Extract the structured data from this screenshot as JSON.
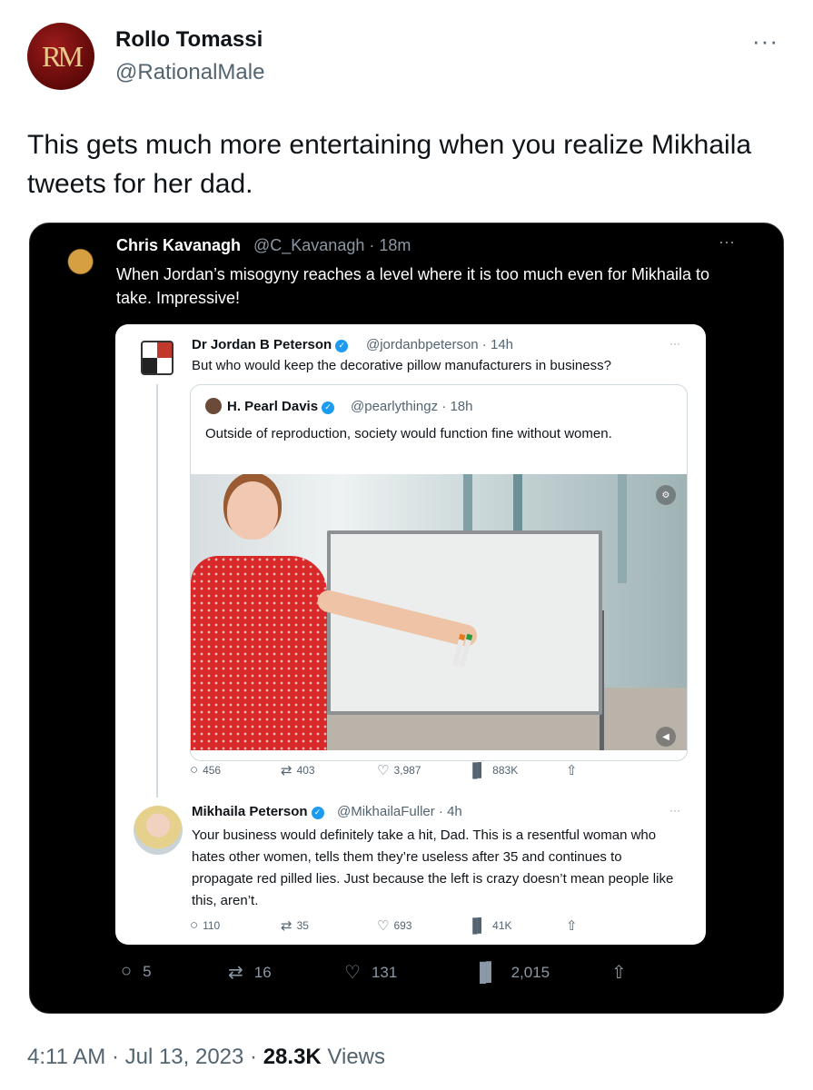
{
  "outer_tweet": {
    "avatar_text": "RM",
    "author_name": "Rollo Tomassi",
    "author_handle": "@RationalMale",
    "more": "···",
    "text": "This gets much more entertaining when you realize Mikhaila tweets for her dad.",
    "timestamp": "4:11 AM · Jul 13, 2023 ·",
    "views_count": "28.3K",
    "views_label": "Views"
  },
  "screenshot": {
    "chris": {
      "name": "Chris Kavanagh",
      "handle": "@C_Kavanagh · 18m",
      "more": "···",
      "text": "When Jordan’s misogyny reaches a level where it is too much even for Mikhaila to take. Impressive!"
    },
    "jordan": {
      "name": "Dr Jordan B Peterson",
      "handle": "@jordanbpeterson · 14h",
      "more": "···",
      "text": "But who would keep the decorative pillow manufacturers in business?",
      "quote": {
        "name": "H. Pearl Davis",
        "handle": "@pearlythingz · 18h",
        "text": "Outside of reproduction, society would function fine without women."
      },
      "actions": {
        "replies": "456",
        "retweets": "403",
        "likes": "3,987",
        "views": "883K"
      }
    },
    "mikhaila": {
      "name": "Mikhaila Peterson",
      "handle": "@MikhailaFuller · 4h",
      "more": "···",
      "text": "Your business would definitely take a hit, Dad. This is a resentful woman who hates other women, tells them they’re useless after 35 and continues to propagate red pilled lies. Just because the left is crazy doesn’t mean people like this, aren’t.",
      "actions": {
        "replies": "110",
        "retweets": "35",
        "likes": "693",
        "views": "41K"
      }
    },
    "actions": {
      "replies": "5",
      "retweets": "16",
      "likes": "131",
      "views": "2,015"
    }
  },
  "icons": {
    "reply": "○",
    "retweet": "⇄",
    "like": "♡",
    "views": "▐▍",
    "share": "⇧",
    "verified": "✓"
  },
  "colors": {
    "verified_blue": "#1d9bf0",
    "secondary_text": "#536471"
  }
}
